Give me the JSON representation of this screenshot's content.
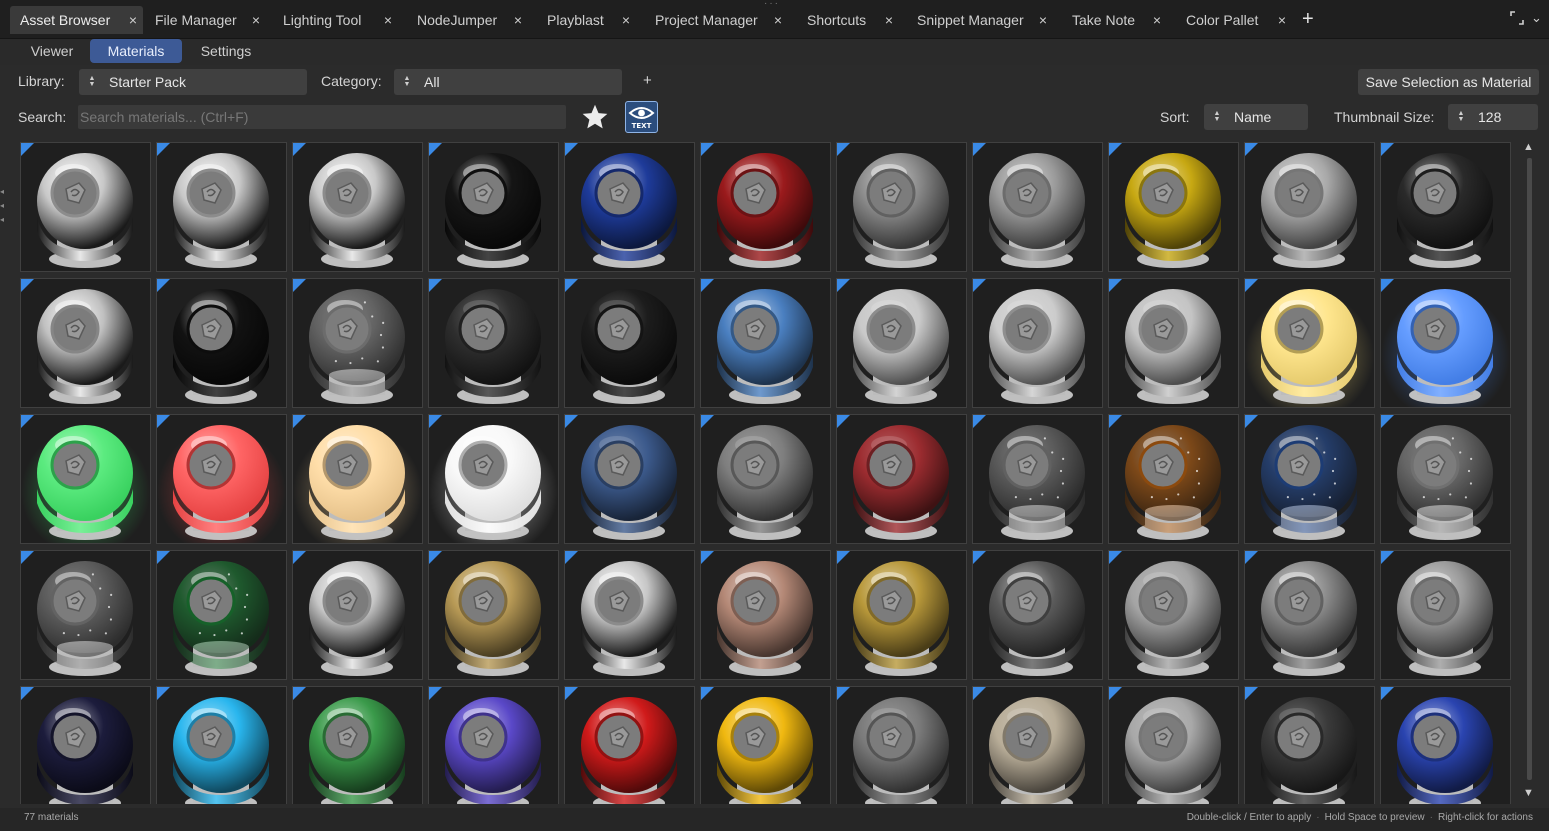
{
  "tabs": [
    {
      "label": "Asset Browser",
      "active": true
    },
    {
      "label": "File Manager",
      "active": false
    },
    {
      "label": "Lighting Tool",
      "active": false
    },
    {
      "label": "NodeJumper",
      "active": false
    },
    {
      "label": "Playblast",
      "active": false
    },
    {
      "label": "Project Manager",
      "active": false
    },
    {
      "label": "Shortcuts",
      "active": false
    },
    {
      "label": "Snippet Manager",
      "active": false
    },
    {
      "label": "Take Note",
      "active": false
    },
    {
      "label": "Color Pallet",
      "active": false
    }
  ],
  "tab_close_glyph": "×",
  "tab_add_glyph": "+",
  "pane_menu_glyph": "⌄",
  "drag_handle_glyph": "···",
  "subtabs": [
    {
      "label": "Viewer",
      "active": false
    },
    {
      "label": "Materials",
      "active": true
    },
    {
      "label": "Settings",
      "active": false
    }
  ],
  "library": {
    "label": "Library:",
    "value": "Starter Pack"
  },
  "category": {
    "label": "Category:",
    "value": "All"
  },
  "add_category_glyph": "+",
  "save_button": "Save Selection as Material",
  "search": {
    "label": "Search:",
    "placeholder": "Search materials... (Ctrl+F)",
    "value": ""
  },
  "favorites_icon": "star-icon",
  "text_view_icon": "eye-text-icon",
  "text_view_label": "TEXT",
  "sort": {
    "label": "Sort:",
    "value": "Name"
  },
  "thumbnail_size": {
    "label": "Thumbnail Size:",
    "value": "128"
  },
  "status": {
    "count": "77 materials",
    "hint_apply": "Double-click / Enter to apply",
    "hint_preview": "Hold Space to preview",
    "hint_actions": "Right-click for actions"
  },
  "colors": {
    "accent": "#3d5a96",
    "thumb_badge": "#3a8ae6",
    "background": "#2b2b2b"
  },
  "materials": [
    {
      "color": "#c8c8c8",
      "style": "chrome"
    },
    {
      "color": "#c8c8c8",
      "style": "chrome"
    },
    {
      "color": "#c8c8c8",
      "style": "chrome"
    },
    {
      "color": "#151515",
      "style": "gloss"
    },
    {
      "color": "#1e3b9a",
      "style": "gloss"
    },
    {
      "color": "#9a1a1c",
      "style": "gloss"
    },
    {
      "color": "#8a8a8a",
      "style": "metal"
    },
    {
      "color": "#9a9a9a",
      "style": "metal"
    },
    {
      "color": "#c7a812",
      "style": "gloss"
    },
    {
      "color": "#a8a8a8",
      "style": "metal"
    },
    {
      "color": "#2a2a2a",
      "style": "metal"
    },
    {
      "color": "#c0c0c0",
      "style": "chrome"
    },
    {
      "color": "#121212",
      "style": "gloss"
    },
    {
      "color": "#9a9a9a",
      "style": "glass"
    },
    {
      "color": "#2e2e2e",
      "style": "matte"
    },
    {
      "color": "#1c1c1c",
      "style": "matte"
    },
    {
      "color": "#4a7fc0",
      "style": "gloss"
    },
    {
      "color": "#c9c9c9",
      "style": "matte"
    },
    {
      "color": "#cccccc",
      "style": "matte"
    },
    {
      "color": "#c4c4c4",
      "style": "matte"
    },
    {
      "color": "#ffe27a",
      "style": "emissive"
    },
    {
      "color": "#4a8cff",
      "style": "emissive"
    },
    {
      "color": "#3fe86a",
      "style": "emissive"
    },
    {
      "color": "#ff4a4a",
      "style": "emissive"
    },
    {
      "color": "#ffd89a",
      "style": "emissive"
    },
    {
      "color": "#f8f8f8",
      "style": "emissive"
    },
    {
      "color": "#3c5a8c",
      "style": "matte"
    },
    {
      "color": "#7e7e7e",
      "style": "matte"
    },
    {
      "color": "#9c2c30",
      "style": "matte"
    },
    {
      "color": "#8a8a8a",
      "style": "glass"
    },
    {
      "color": "#c86a14",
      "style": "glass"
    },
    {
      "color": "#2a56a6",
      "style": "glass"
    },
    {
      "color": "#a0a0a0",
      "style": "glass"
    },
    {
      "color": "#8e8e8e",
      "style": "glass"
    },
    {
      "color": "#1f8a3a",
      "style": "glass"
    },
    {
      "color": "#c6c6c6",
      "style": "chrome"
    },
    {
      "color": "#b89a56",
      "style": "metal"
    },
    {
      "color": "#c6c6c6",
      "style": "chrome"
    },
    {
      "color": "#b48876",
      "style": "metal"
    },
    {
      "color": "#b8983a",
      "style": "metal"
    },
    {
      "color": "#5a5a5a",
      "style": "metal"
    },
    {
      "color": "#a4a4a4",
      "style": "matte"
    },
    {
      "color": "#8a8a8a",
      "style": "metal"
    },
    {
      "color": "#9a9a9a",
      "style": "metal"
    },
    {
      "color": "#1c1c3c",
      "style": "gloss"
    },
    {
      "color": "#29b6ee",
      "style": "gloss"
    },
    {
      "color": "#3a9a4a",
      "style": "gloss"
    },
    {
      "color": "#5a48c8",
      "style": "gloss"
    },
    {
      "color": "#d01a1a",
      "style": "gloss"
    },
    {
      "color": "#f0b810",
      "style": "gloss"
    },
    {
      "color": "#7a7a7a",
      "style": "matte"
    },
    {
      "color": "#b8ad98",
      "style": "matte"
    },
    {
      "color": "#a8a8a8",
      "style": "matte"
    },
    {
      "color": "#3a3a3a",
      "style": "matte"
    },
    {
      "color": "#2a44b0",
      "style": "gloss"
    }
  ]
}
